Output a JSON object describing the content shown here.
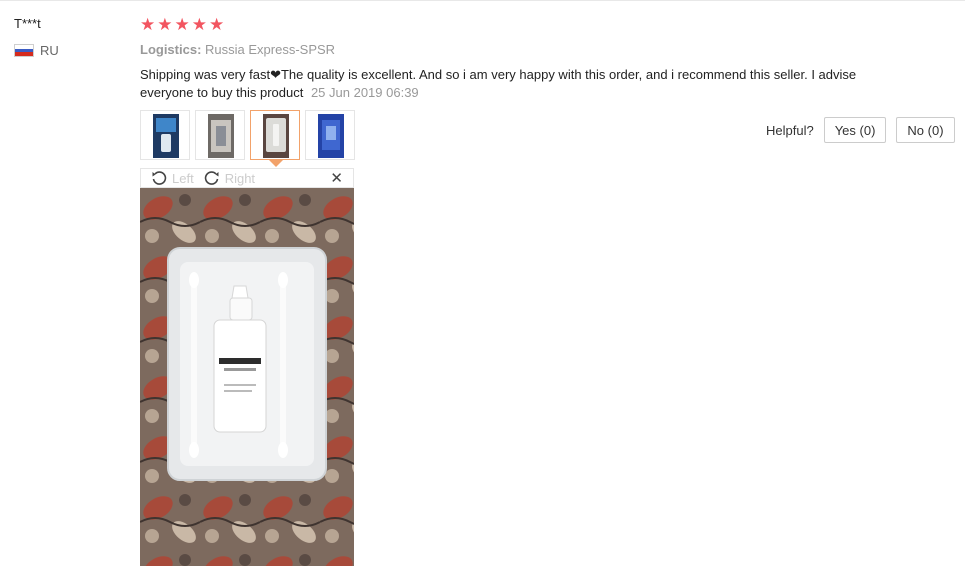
{
  "review": {
    "user_name": "T***t",
    "country_code": "RU",
    "rating": 5,
    "logistics_label": "Logistics:",
    "logistics_value": "Russia Express-SPSR",
    "feedback_text": "Shipping was very fast❤The quality is excellent. And so i am very happy with this order, and i recommend this seller. I advise everyone to buy this product",
    "date": "25 Jun 2019 06:39"
  },
  "viewer": {
    "rotate_left_label": "Left",
    "rotate_right_label": "Right",
    "close_glyph": "✕"
  },
  "helpful": {
    "label": "Helpful?",
    "yes_label": "Yes (0)",
    "no_label": "No (0)"
  },
  "colors": {
    "star": "#f25560",
    "active_thumb": "#f2a26a",
    "meta_gray": "#999999"
  },
  "icons": {
    "star": "star-icon",
    "rotate_left": "rotate-left-icon",
    "rotate_right": "rotate-right-icon",
    "close": "close-icon",
    "flag": "russia-flag-icon"
  }
}
